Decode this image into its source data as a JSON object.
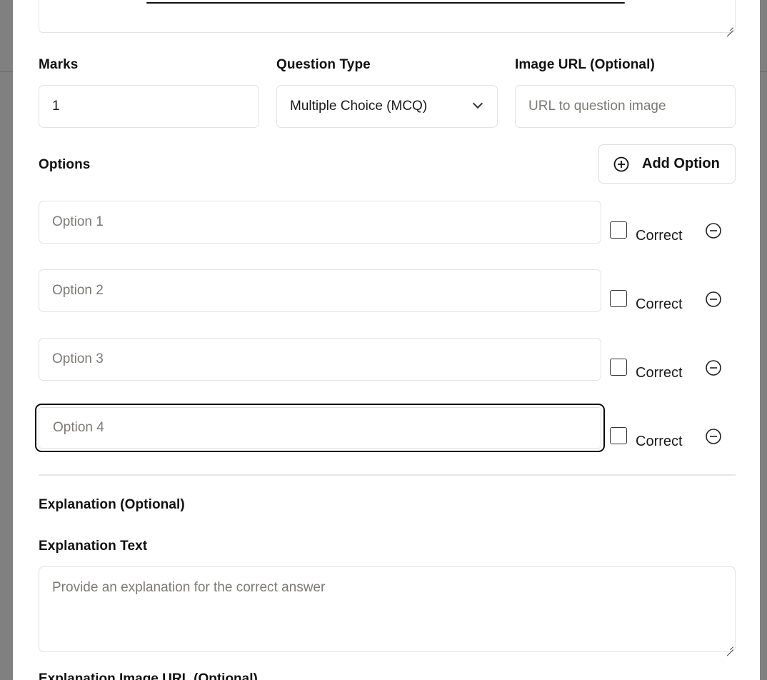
{
  "form": {
    "marks_label": "Marks",
    "marks_value": "1",
    "question_type_label": "Question Type",
    "question_type_value": "Multiple Choice (MCQ)",
    "image_url_label": "Image URL (Optional)",
    "image_url_placeholder": "URL to question image",
    "options_label": "Options",
    "add_option_label": "Add Option",
    "options": [
      {
        "placeholder": "Option 1",
        "correct_label": "Correct",
        "checked": false
      },
      {
        "placeholder": "Option 2",
        "correct_label": "Correct",
        "checked": false
      },
      {
        "placeholder": "Option 3",
        "correct_label": "Correct",
        "checked": false
      },
      {
        "placeholder": "Option 4",
        "correct_label": "Correct",
        "checked": false
      }
    ],
    "explanation_section_label": "Explanation (Optional)",
    "explanation_text_label": "Explanation Text",
    "explanation_placeholder": "Provide an explanation for the correct answer",
    "explanation_image_label": "Explanation Image URL (Optional)"
  },
  "icons": {
    "add": "plus-circle-icon",
    "remove": "minus-circle-icon",
    "dropdown": "chevron-down-icon"
  },
  "colors": {
    "border": "#e2e2e2",
    "focus_border": "#0b0b0b",
    "placeholder": "#7d7a75",
    "backdrop": "#808080"
  }
}
